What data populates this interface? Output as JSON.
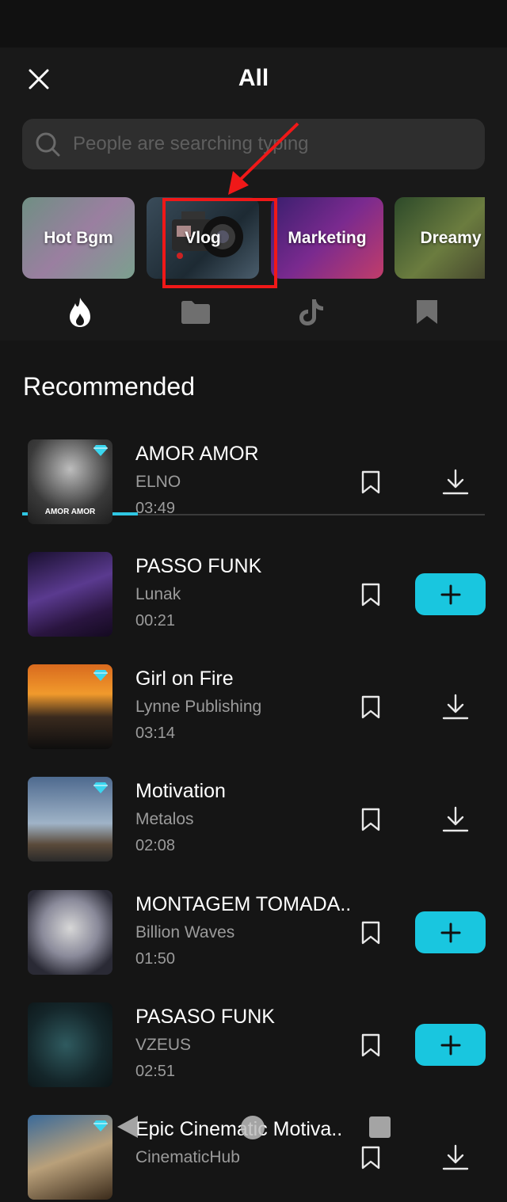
{
  "header": {
    "title": "All"
  },
  "search": {
    "placeholder": "People are searching typing"
  },
  "categories": [
    {
      "label": "Hot Bgm"
    },
    {
      "label": "Vlog"
    },
    {
      "label": "Marketing"
    },
    {
      "label": "Dreamy"
    }
  ],
  "tabs": [
    {
      "name": "hot",
      "icon": "flame-icon",
      "active": true
    },
    {
      "name": "folder",
      "icon": "folder-icon",
      "active": false
    },
    {
      "name": "tiktok",
      "icon": "tiktok-icon",
      "active": false
    },
    {
      "name": "saved",
      "icon": "bookmark-icon",
      "active": false
    }
  ],
  "section": {
    "title": "Recommended"
  },
  "songs": [
    {
      "title": "AMOR AMOR",
      "artist": "ELNO",
      "duration": "03:49",
      "premium": true,
      "action": "download",
      "thumb_text": "AMOR AMOR"
    },
    {
      "title": "PASSO FUNK",
      "artist": "Lunak",
      "duration": "00:21",
      "premium": false,
      "action": "add",
      "thumb_text": ""
    },
    {
      "title": "Girl on Fire",
      "artist": "Lynne Publishing",
      "duration": "03:14",
      "premium": true,
      "action": "download",
      "thumb_text": ""
    },
    {
      "title": "Motivation",
      "artist": "Metalos",
      "duration": "02:08",
      "premium": true,
      "action": "download",
      "thumb_text": ""
    },
    {
      "title": "MONTAGEM TOMADA..",
      "artist": "Billion Waves",
      "duration": "01:50",
      "premium": false,
      "action": "add",
      "thumb_text": ""
    },
    {
      "title": "PASASO FUNK",
      "artist": "VZEUS",
      "duration": "02:51",
      "premium": false,
      "action": "add",
      "thumb_text": ""
    },
    {
      "title": "Epic Cinematic Motiva..",
      "artist": "CinematicHub",
      "duration": "",
      "premium": true,
      "action": "download",
      "thumb_text": ""
    }
  ],
  "colors": {
    "accent": "#19c6df",
    "annotation": "#f01818",
    "background": "#151515"
  }
}
